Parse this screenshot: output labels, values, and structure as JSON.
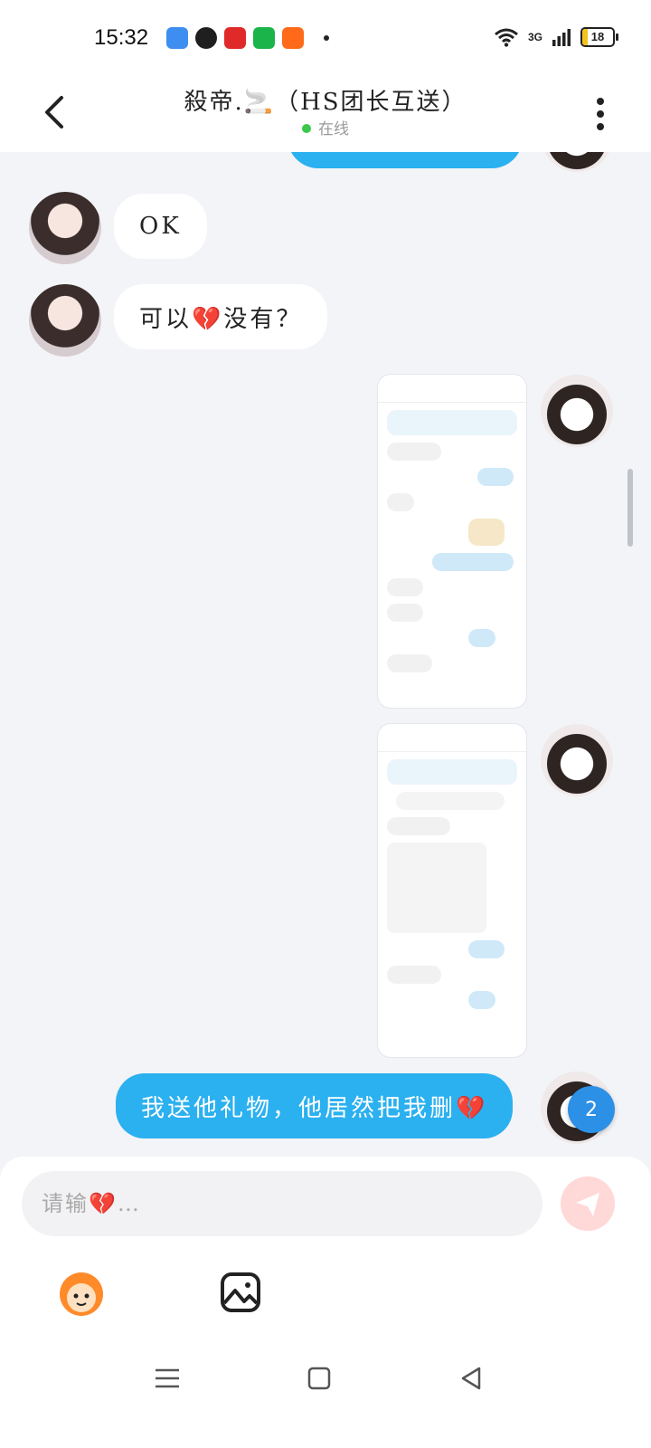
{
  "status_bar": {
    "time": "15:32",
    "network": "3G",
    "battery": "18",
    "app_icons": [
      "blue-app-icon",
      "wechat-icon",
      "red-app-icon",
      "green-app-icon",
      "orange-app-icon"
    ]
  },
  "header": {
    "title": "殺帝.🚬（HS团长互送）",
    "status": "在线"
  },
  "messages": [
    {
      "side": "in",
      "text": "OK"
    },
    {
      "side": "in",
      "text": "可以💔没有？"
    },
    {
      "side": "out",
      "type": "image"
    },
    {
      "side": "out",
      "type": "image"
    },
    {
      "side": "out",
      "text": "我送他礼物，他居然把我删💔"
    }
  ],
  "unread_badge": "2",
  "composer": {
    "placeholder": "请输💔…"
  },
  "colors": {
    "accent": "#2bb0f0",
    "online": "#3cc74a",
    "send_button": "#ffd8d8"
  }
}
